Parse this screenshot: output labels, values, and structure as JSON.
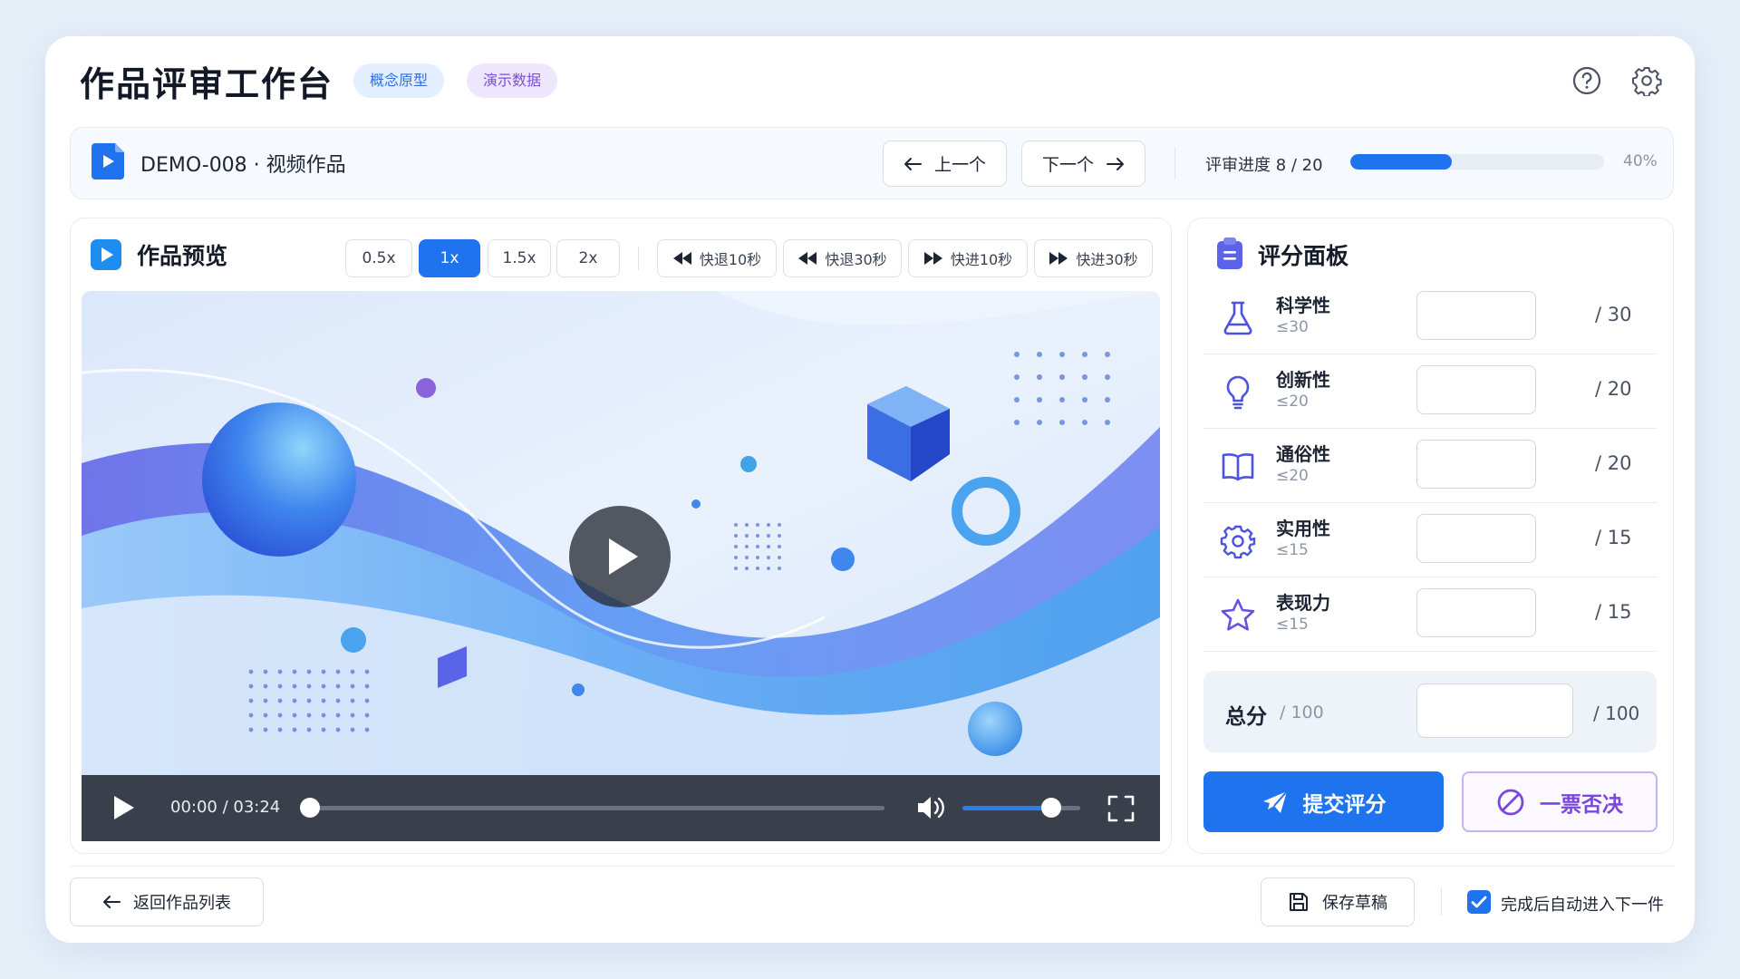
{
  "header": {
    "title": "作品评审工作台",
    "tags": [
      "概念原型",
      "演示数据"
    ],
    "icons": [
      "help-icon",
      "gear-icon"
    ]
  },
  "work": {
    "id_label": "DEMO-008 · 视频作品",
    "prev_label": "上一个",
    "next_label": "下一个",
    "progress_label": "评审进度  8 / 20",
    "progress_fraction": 0.4,
    "progress_pct": "40%"
  },
  "preview": {
    "title": "作品预览",
    "speeds": [
      {
        "label": "0.5x",
        "active": false
      },
      {
        "label": "1x",
        "active": true
      },
      {
        "label": "1.5x",
        "active": false
      },
      {
        "label": "2x",
        "active": false
      }
    ],
    "seek_buttons": [
      {
        "label": "快退10秒",
        "icon": "rewind-icon"
      },
      {
        "label": "快退30秒",
        "icon": "rewind-icon"
      },
      {
        "label": "快进10秒",
        "icon": "fast-forward-icon"
      },
      {
        "label": "快进30秒",
        "icon": "fast-forward-icon"
      }
    ],
    "player": {
      "time": "00:00  /  03:24",
      "position_fraction": 0.0,
      "volume_fraction": 0.75
    }
  },
  "scoring": {
    "title": "评分面板",
    "criteria": [
      {
        "name": "科学性",
        "hint": "≤30",
        "max": "/  30",
        "icon": "flask-icon",
        "value": ""
      },
      {
        "name": "创新性",
        "hint": "≤20",
        "max": "/  20",
        "icon": "lightbulb-icon",
        "value": ""
      },
      {
        "name": "通俗性",
        "hint": "≤20",
        "max": "/  20",
        "icon": "book-icon",
        "value": ""
      },
      {
        "name": "实用性",
        "hint": "≤15",
        "max": "/  15",
        "icon": "gear-icon",
        "value": ""
      },
      {
        "name": "表现力",
        "hint": "≤15",
        "max": "/  15",
        "icon": "star-icon",
        "value": ""
      }
    ],
    "total_label": "总分",
    "total_hint": "/ 100",
    "total_max": "/ 100",
    "total_value": "",
    "submit_label": "提交评分",
    "veto_label": "一票否决"
  },
  "footer": {
    "back_label": "返回作品列表",
    "save_label": "保存草稿",
    "auto_next_label": "完成后自动进入下一件",
    "auto_next_checked": true
  },
  "colors": {
    "accent": "#1f73ee",
    "veto": "#7b46dc",
    "page_bg": "#e6eef8"
  }
}
